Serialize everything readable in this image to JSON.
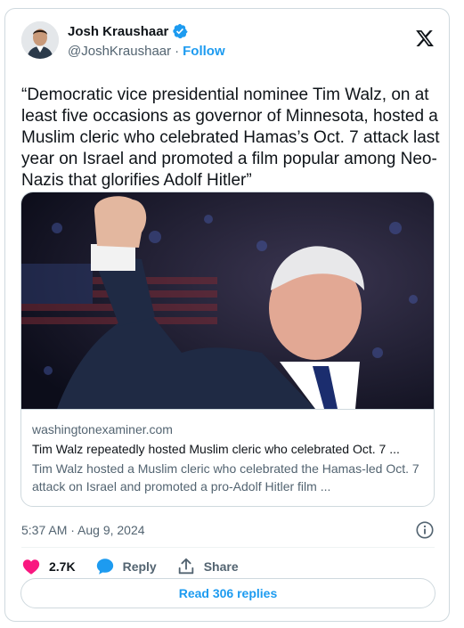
{
  "author": {
    "display_name": "Josh Kraushaar",
    "handle": "@JoshKraushaar",
    "separator": "·",
    "follow_label": "Follow"
  },
  "tweet": {
    "text": "“Democratic vice presidential nominee Tim Walz, on at least five occasions as governor of Minnesota, hosted a Muslim cleric who celebrated Hamas’s Oct. 7 attack last year on Israel and promoted a film popular among Neo-Nazis that glorifies Adolf Hitler”"
  },
  "link_card": {
    "domain": "washingtonexaminer.com",
    "title": "Tim Walz repeatedly hosted Muslim cleric who celebrated Oct. 7 ...",
    "description": "Tim Walz hosted a Muslim cleric who celebrated the Hamas-led Oct. 7 attack on Israel and promoted a pro-Adolf Hitler film ..."
  },
  "timestamp": "5:37 AM · Aug 9, 2024",
  "actions": {
    "like_count": "2.7K",
    "reply_label": "Reply",
    "share_label": "Share"
  },
  "read_replies_label": "Read 306 replies",
  "icons": {
    "verified": "verified-badge-icon",
    "x_logo": "x-logo-icon",
    "info": "info-icon",
    "like": "heart-icon",
    "reply": "speech-bubble-icon",
    "share": "share-upload-icon"
  },
  "colors": {
    "accent": "#1d9bf0",
    "like": "#f91880",
    "text": "#0f1419",
    "muted": "#536471",
    "border": "#cfd9de"
  }
}
